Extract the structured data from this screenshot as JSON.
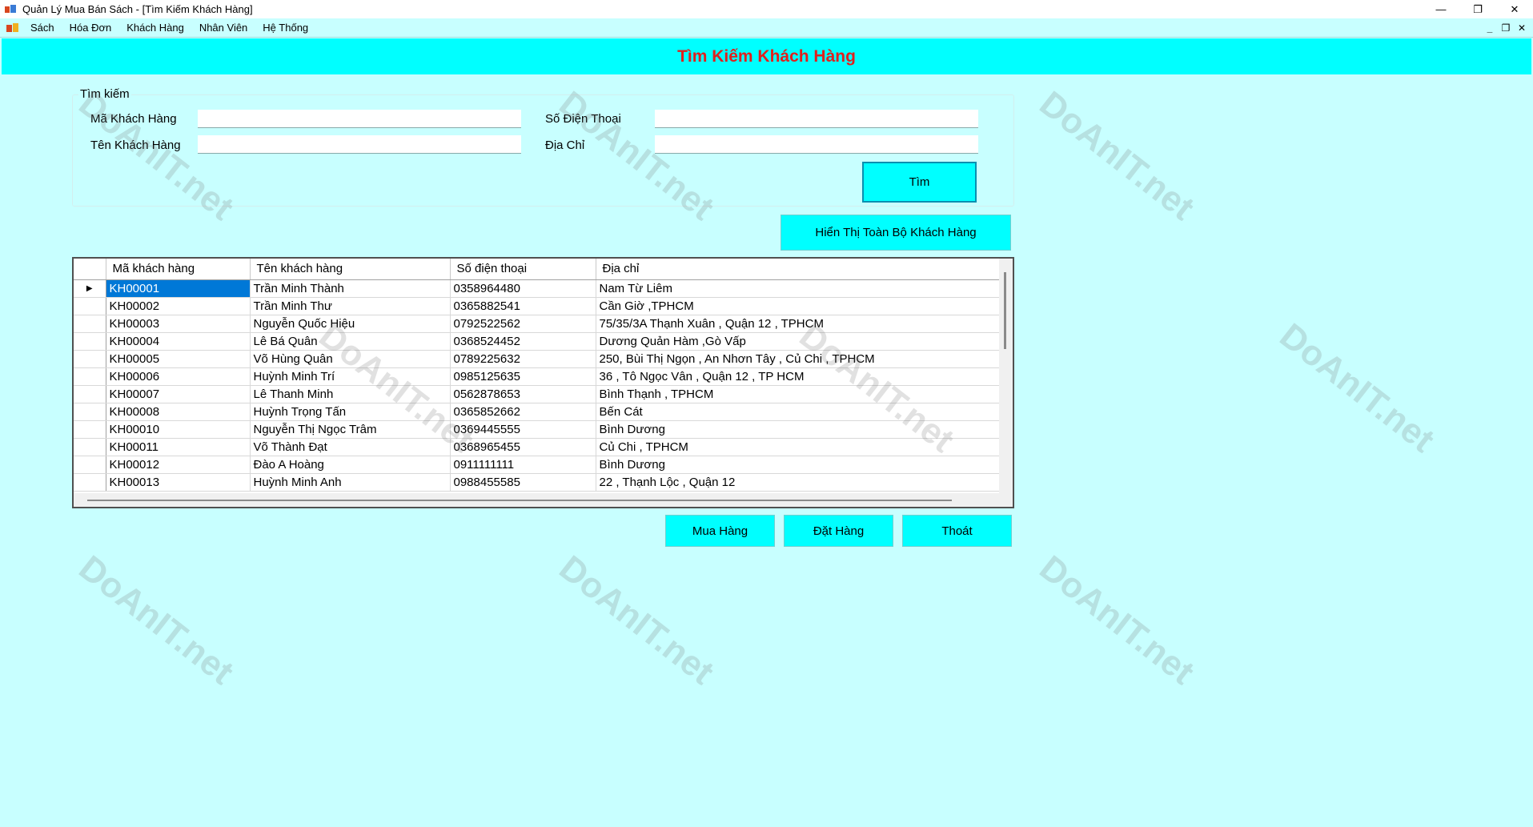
{
  "window": {
    "title": "Quản Lý Mua Bán Sách - [Tìm Kiếm Khách Hàng]",
    "controls": {
      "minimize": "—",
      "maximize": "❐",
      "close": "✕"
    },
    "mdi_controls": {
      "minimize": "_",
      "restore": "❐",
      "close": "✕"
    }
  },
  "menu": {
    "items": [
      {
        "label": "Sách"
      },
      {
        "label": "Hóa Đơn"
      },
      {
        "label": "Khách Hàng"
      },
      {
        "label": "Nhân Viên"
      },
      {
        "label": "Hệ Thống"
      }
    ]
  },
  "header": {
    "title": "Tìm Kiếm Khách Hàng"
  },
  "search": {
    "group_label": "Tìm kiếm",
    "ma_kh_label": "Mã Khách Hàng",
    "ma_kh_value": "",
    "ten_kh_label": "Tên Khách Hàng",
    "ten_kh_value": "",
    "sdt_label": "Số Điện Thoại",
    "sdt_value": "",
    "dia_chi_label": "Địa Chỉ",
    "dia_chi_value": "",
    "tim_button": "Tìm",
    "show_all_button": "Hiển Thị Toàn Bộ Khách Hàng"
  },
  "grid": {
    "columns": [
      "Mã khách hàng",
      "Tên khách hàng",
      "Số điện thoại",
      "Địa chỉ"
    ],
    "current_row_marker": "▶",
    "rows": [
      [
        "KH00001",
        "Trần Minh Thành",
        "0358964480",
        "Nam Từ Liêm"
      ],
      [
        "KH00002",
        "Trần Minh Thư",
        "0365882541",
        "Cần Giờ ,TPHCM"
      ],
      [
        "KH00003",
        "Nguyễn Quốc Hiệu",
        "0792522562",
        "75/35/3A Thạnh Xuân , Quận 12 , TPHCM"
      ],
      [
        "KH00004",
        "Lê Bá Quân",
        "0368524452",
        "Dương Quản Hàm ,Gò Vấp"
      ],
      [
        "KH00005",
        "Võ Hùng Quân",
        "0789225632",
        "250, Bùi Thị Ngọn , An Nhơn Tây , Củ Chi , TPHCM"
      ],
      [
        "KH00006",
        "Huỳnh Minh Trí",
        "0985125635",
        "36 , Tô Ngọc Vân , Quận 12 , TP HCM"
      ],
      [
        "KH00007",
        "Lê Thanh Minh",
        "0562878653",
        "Bình Thạnh , TPHCM"
      ],
      [
        "KH00008",
        "Huỳnh Trọng Tấn",
        "0365852662",
        "Bến Cát"
      ],
      [
        "KH00010",
        "Nguyễn Thị Ngọc Trâm",
        "0369445555",
        "Bình Dương"
      ],
      [
        "KH00011",
        "Võ Thành Đạt",
        "0368965455",
        "Củ Chi , TPHCM"
      ],
      [
        "KH00012",
        "Đào A Hoàng",
        "0911111111",
        "Bình Dương"
      ],
      [
        "KH00013",
        "Huỳnh Minh Anh",
        "0988455585",
        "22 , Thạnh Lộc , Quận 12"
      ]
    ]
  },
  "actions": {
    "mua_hang": "Mua Hàng",
    "dat_hang": "Đặt Hàng",
    "thoat": "Thoát"
  },
  "watermark": {
    "text": "DoAnIT.net"
  }
}
